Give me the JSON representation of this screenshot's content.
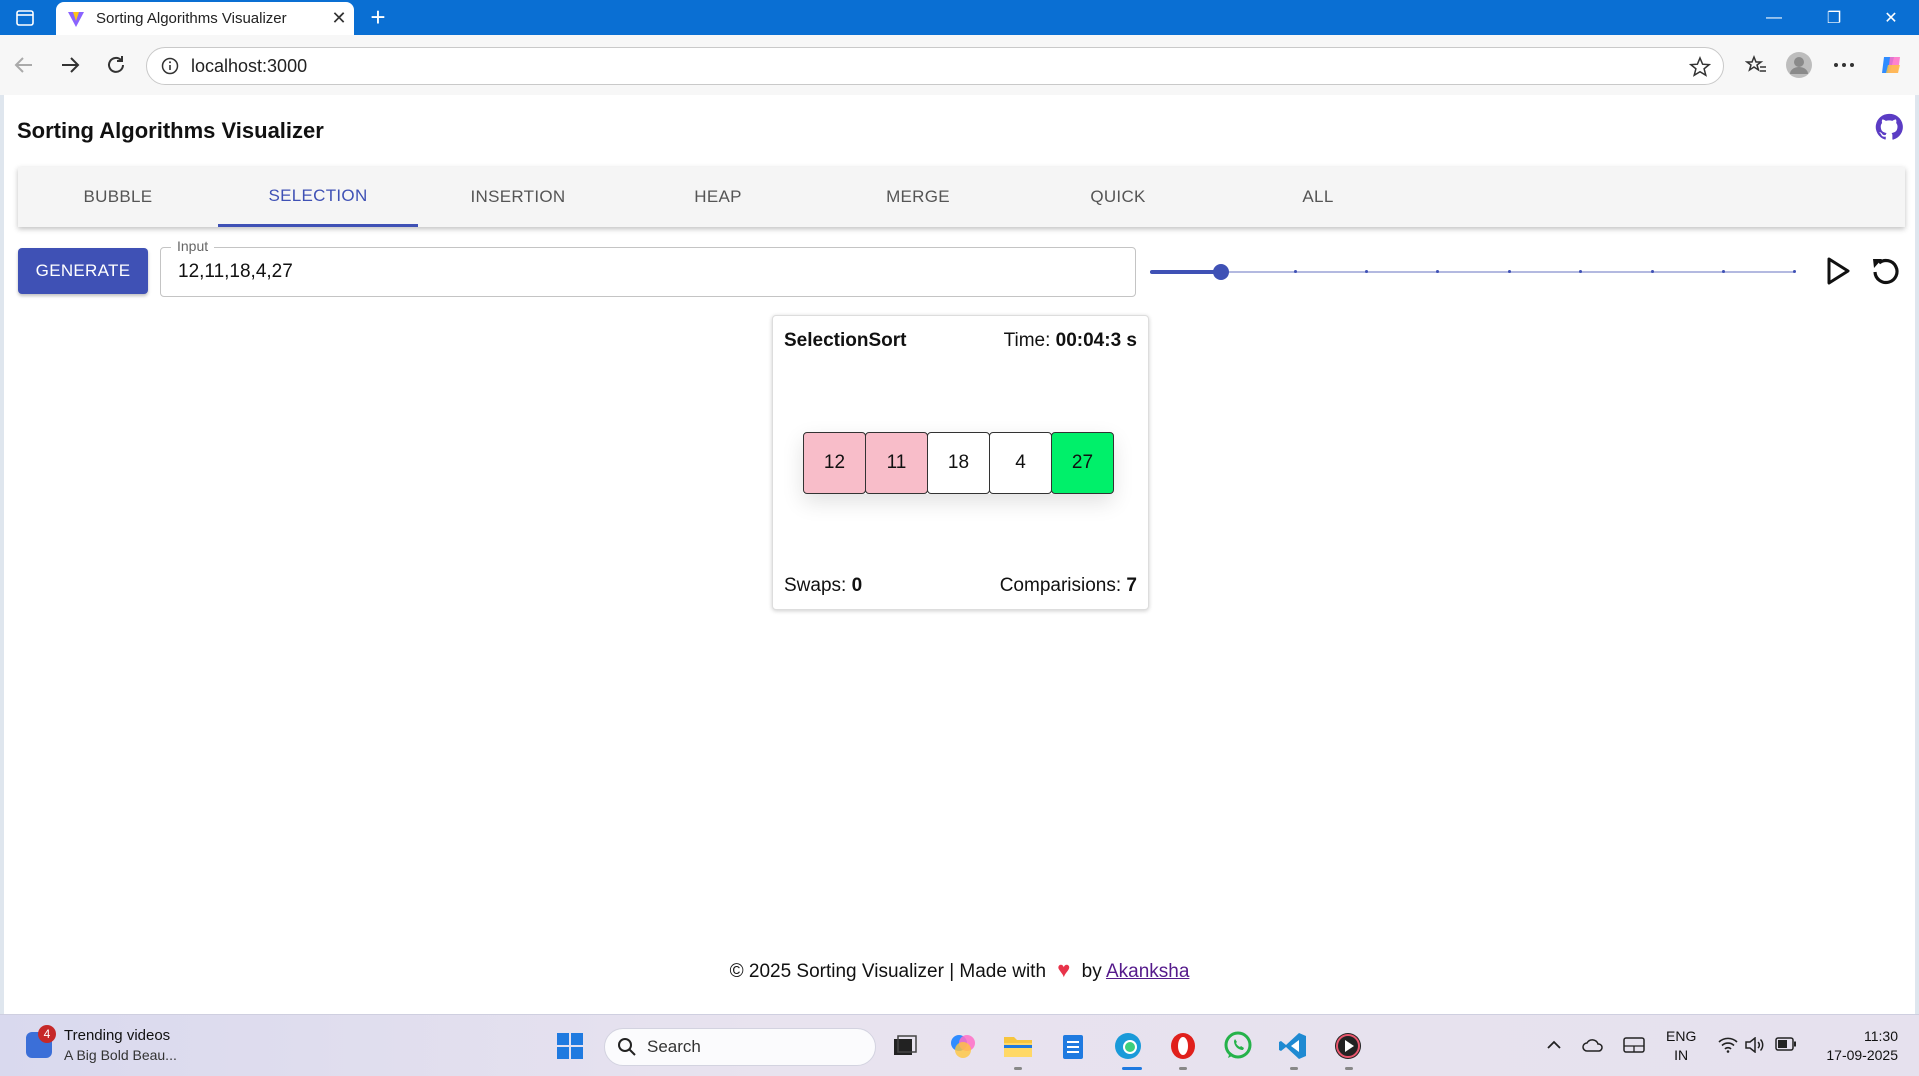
{
  "browser": {
    "tab_title": "Sorting Algorithms Visualizer",
    "url": "localhost:3000"
  },
  "app": {
    "title": "Sorting Algorithms Visualizer",
    "tabs": [
      {
        "label": "BUBBLE"
      },
      {
        "label": "SELECTION"
      },
      {
        "label": "INSERTION"
      },
      {
        "label": "HEAP"
      },
      {
        "label": "MERGE"
      },
      {
        "label": "QUICK"
      },
      {
        "label": "ALL"
      }
    ],
    "active_tab": "SELECTION",
    "generate_label": "GENERATE",
    "input_label": "Input",
    "input_value": "12,11,18,4,27",
    "speed_slider_value": 0.11,
    "accent_color": "#3f51b5"
  },
  "card": {
    "title": "SelectionSort",
    "time_label": "Time:",
    "time_value": "00:04:3 s",
    "cells": [
      {
        "value": "12",
        "color": "#f8bdc9"
      },
      {
        "value": "11",
        "color": "#f8bdc9"
      },
      {
        "value": "18",
        "color": "#ffffff"
      },
      {
        "value": "4",
        "color": "#ffffff"
      },
      {
        "value": "27",
        "color": "#00f06a"
      }
    ],
    "swaps_label": "Swaps:",
    "swaps_value": "0",
    "comparisons_label": "Comparisions:",
    "comparisons_value": "7"
  },
  "footer": {
    "text_before": "© 2025 Sorting Visualizer | Made with",
    "text_by": "by",
    "author": "Akanksha"
  },
  "taskbar": {
    "badge_count": "4",
    "widget_title": "Trending videos",
    "widget_subtitle": "A Big Bold Beau...",
    "search_placeholder": "Search",
    "lang_line1": "ENG",
    "lang_line2": "IN",
    "time": "11:30",
    "date": "17-09-2025"
  }
}
